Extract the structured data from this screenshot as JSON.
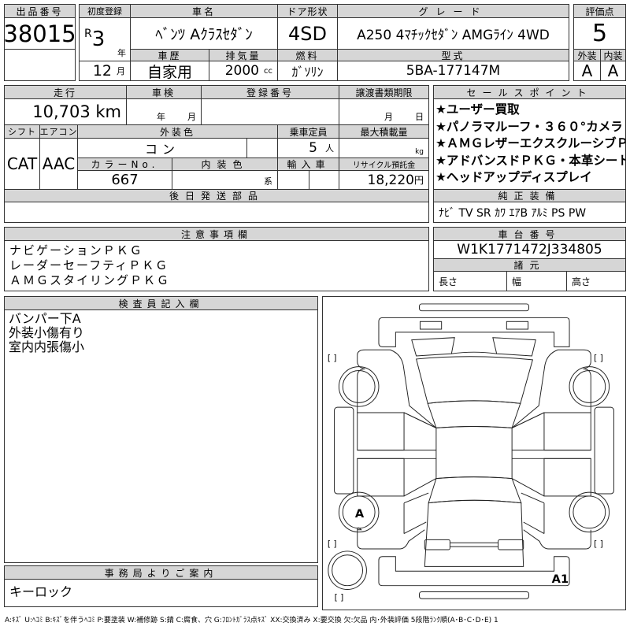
{
  "lot": {
    "label": "出品番号",
    "value": "38015"
  },
  "first_reg": {
    "label": "初度登録",
    "era": "R",
    "year": "3",
    "year_unit": "年",
    "month": "12",
    "month_unit": "月"
  },
  "car_name": {
    "label": "車名",
    "value": "ﾍﾞﾝﾂ Aｸﾗｽｾﾀﾞﾝ"
  },
  "door": {
    "label": "ドア形状",
    "value": "4SD"
  },
  "grade": {
    "label": "グレード",
    "value": "A250 4ﾏﾁｯｸｾﾀﾞﾝ AMGﾗｲﾝ 4WD"
  },
  "history": {
    "label": "車歴",
    "value": "自家用"
  },
  "displacement": {
    "label": "排気量",
    "value": "2000",
    "unit": "cc"
  },
  "fuel": {
    "label": "燃料",
    "value": "ｶﾞｿﾘﾝ"
  },
  "model": {
    "label": "型式",
    "value": "5BA-177147M"
  },
  "score": {
    "label": "評価点",
    "value": "5",
    "ext_label": "外装",
    "int_label": "内装",
    "ext": "A",
    "int": "A"
  },
  "mileage": {
    "label": "走行",
    "value": "10,703 km"
  },
  "inspection": {
    "label": "車検",
    "year_unit": "年",
    "month_unit": "月"
  },
  "reg_number": {
    "label": "登録番号"
  },
  "transfer": {
    "label": "譲渡書類期限",
    "month_unit": "月",
    "day_unit": "日"
  },
  "shift": {
    "label": "シフト",
    "value": "CAT"
  },
  "aircon": {
    "label": "エアコン",
    "value": "AAC"
  },
  "ext_color": {
    "label": "外装色",
    "value": "コン"
  },
  "capacity": {
    "label": "乗車定員",
    "value": "5",
    "unit": "人"
  },
  "max_load": {
    "label": "最大積載量",
    "unit": "kg"
  },
  "color_no": {
    "label": "カラーNo.",
    "value": "667"
  },
  "int_color": {
    "label": "内装色",
    "unit": "系"
  },
  "import": {
    "label": "輸入車"
  },
  "recycle": {
    "label": "リサイクル預託金",
    "value": "18,220",
    "unit": "円"
  },
  "later_parts": {
    "label": "後日発送部品"
  },
  "sales_points": {
    "label": "セールスポイント",
    "items": [
      "★ユーザー買取",
      "★パノラマルーフ・３６０°カメラ",
      "★ＡＭＧレザーエクスクルーシブＰ",
      "★アドバンスドＰＫＧ・本革シート",
      "★ヘッドアップディスプレイ"
    ]
  },
  "equipment": {
    "label": "純正装備",
    "value": "ﾅﾋﾞ TV SR ｶﾜ ｴｱB ｱﾙﾐ PS PW"
  },
  "notes": {
    "label": "注意事項欄",
    "items": [
      "ナビゲーションＰＫＧ",
      "レーダーセーフティＰＫＧ",
      "ＡＭＧスタイリングＰＫＧ"
    ]
  },
  "chassis": {
    "label": "車台番号",
    "value": "W1K1771472J334805"
  },
  "specs": {
    "label": "諸元",
    "length": "長さ",
    "width": "幅",
    "height": "高さ"
  },
  "inspector": {
    "label": "検査員記入欄",
    "items": [
      "バンパー下A",
      "外装小傷有り",
      "室内内張傷小"
    ]
  },
  "office": {
    "label": "事務局よりご案内",
    "value": "キーロック"
  },
  "diagram": {
    "marks": {
      "left_rear_wheel": "A",
      "rear_bumper": "A1"
    },
    "bracket": "[      ]"
  },
  "footer": "A:ｷｽﾞ U:ﾍｺﾐ B:ｷｽﾞを伴うﾍｺﾐ P:要塗装 W:補修跡 S:錆 C:腐食、穴 G:ﾌﾛﾝﾄｶﾞﾗｽ点ｷｽﾞ XX:交換済み X:要交換 欠:欠品 内･外装評価 5段階ﾗﾝｸ順(A･B･C･D･E) 1"
}
